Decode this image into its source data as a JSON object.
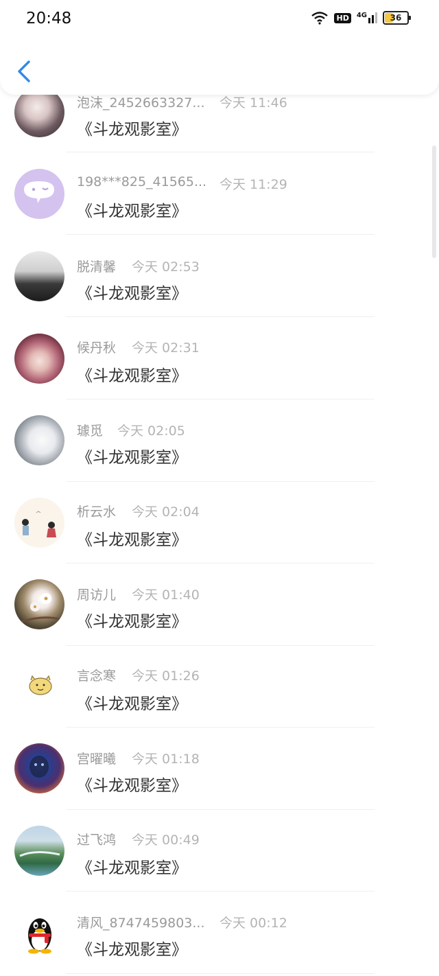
{
  "status_bar": {
    "time": "20:48",
    "hd_label": "HD",
    "network_label": "4G",
    "battery_level": "36"
  },
  "header": {
    "back_icon": "chevron-left-icon"
  },
  "messages": [
    {
      "name": "泡沫_2452663327...",
      "time": "今天 11:46",
      "text": "《斗龙观影室》",
      "avatar": "anime-boy-avatar"
    },
    {
      "name": "198***825_41565...",
      "time": "今天 11:29",
      "text": "《斗龙观影室》",
      "avatar": "chat-bubble-avatar"
    },
    {
      "name": "脱清馨",
      "time": "今天 02:53",
      "text": "《斗龙观影室》",
      "avatar": "bw-photo-avatar"
    },
    {
      "name": "候丹秋",
      "time": "今天 02:31",
      "text": "《斗龙观影室》",
      "avatar": "girl-flowers-avatar"
    },
    {
      "name": "璩觅",
      "time": "今天 02:05",
      "text": "《斗龙观影室》",
      "avatar": "couple-avatar"
    },
    {
      "name": "析云水",
      "time": "今天 02:04",
      "text": "《斗龙观影室》",
      "avatar": "illustration-couple-avatar"
    },
    {
      "name": "周访儿",
      "time": "今天 01:40",
      "text": "《斗龙观影室》",
      "avatar": "blossom-avatar"
    },
    {
      "name": "言念寒",
      "time": "今天 01:26",
      "text": "《斗龙观影室》",
      "avatar": "yellow-cat-avatar"
    },
    {
      "name": "宫曜曦",
      "time": "今天 01:18",
      "text": "《斗龙观影室》",
      "avatar": "lion-avatar"
    },
    {
      "name": "过飞鸿",
      "time": "今天 00:49",
      "text": "《斗龙观影室》",
      "avatar": "landscape-avatar"
    },
    {
      "name": "清风_8747459803...",
      "time": "今天 00:12",
      "text": "《斗龙观影室》",
      "avatar": "qq-penguin-avatar"
    }
  ]
}
